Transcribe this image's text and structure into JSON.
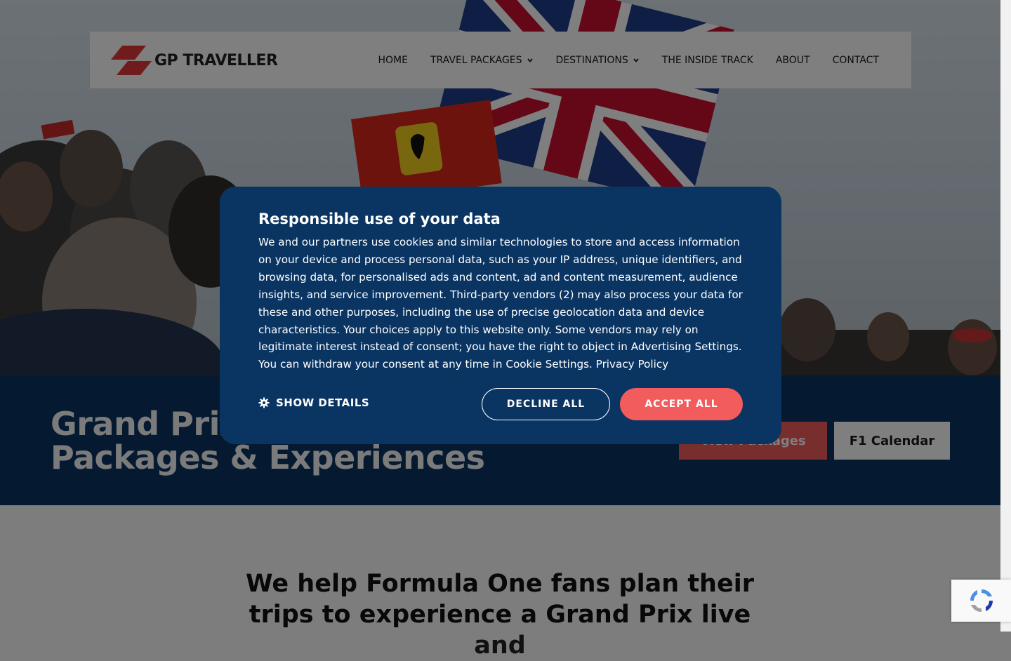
{
  "header": {
    "logo_text": "GP TRAVELLER",
    "nav": [
      {
        "label": "HOME",
        "dropdown": false
      },
      {
        "label": "TRAVEL PACKAGES",
        "dropdown": true
      },
      {
        "label": "DESTINATIONS",
        "dropdown": true
      },
      {
        "label": "THE INSIDE TRACK",
        "dropdown": false
      },
      {
        "label": "ABOUT",
        "dropdown": false
      },
      {
        "label": "CONTACT",
        "dropdown": false
      }
    ]
  },
  "hero_band": {
    "headline_line1": "Grand Prix Travel",
    "headline_line2": "Packages & Experiences",
    "primary_button": "View Packages",
    "secondary_button": "F1 Calendar"
  },
  "intro": {
    "tagline_line1": "We help Formula One fans plan their",
    "tagline_line2": "trips to experience a Grand Prix live and"
  },
  "cookie_modal": {
    "title": "Responsible use of your data",
    "body": "We and our partners use cookies and similar technologies to store and access information on your device and process personal data, such as your IP address, unique identifiers, and browsing data, for personalised ads and content, ad and content measurement, audience insights, and service improvement. Third-party vendors (2) may also process your data for these and other purposes, including the use of precise geolocation data and device characteristics. Your choices apply to this website only. Some vendors may rely on legitimate interest instead of consent; you have the right to object in Advertising Settings. You can withdraw your consent at any time in Cookie Settings.",
    "privacy_link": "Privacy Policy",
    "show_details": "SHOW DETAILS",
    "decline": "DECLINE ALL",
    "accept": "ACCEPT ALL"
  },
  "colors": {
    "brand_red": "#f25c5c",
    "navy": "#0a3563"
  }
}
